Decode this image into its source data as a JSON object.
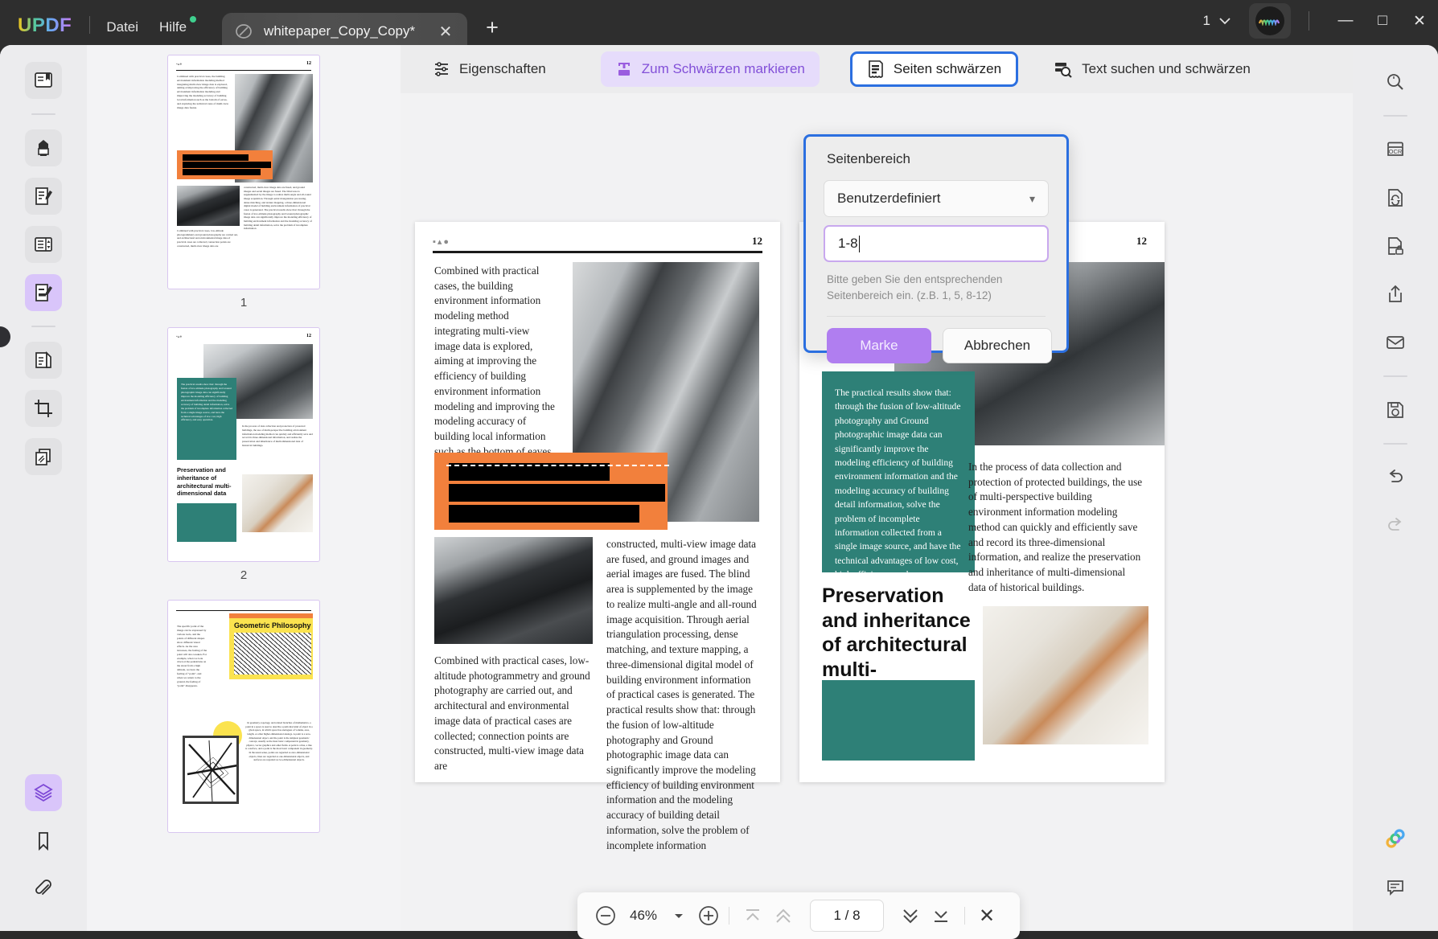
{
  "titlebar": {
    "logo": "UPDF",
    "menus": [
      "Datei",
      "Hilfe"
    ],
    "tab": {
      "title": "whitepaper_Copy_Copy*",
      "close": "✕",
      "add": "+",
      "icon": "document-slash-icon"
    },
    "window_count": "1",
    "chevron": "⌄",
    "minimize": "—",
    "maximize": "□",
    "close": "✕"
  },
  "left_rail": {
    "items": [
      {
        "name": "reader-mode",
        "icon": "book-bookmark-icon",
        "state": "idle"
      },
      {
        "name": "highlight-tool",
        "icon": "marker-pen-icon",
        "state": "idle"
      },
      {
        "name": "annotate-tool",
        "icon": "document-pen-icon",
        "state": "idle"
      },
      {
        "name": "organize-pages",
        "icon": "page-list-icon",
        "state": "idle"
      },
      {
        "name": "redact-tool",
        "icon": "document-edit-icon",
        "state": "active"
      },
      {
        "name": "page-tool",
        "icon": "document-copy-icon",
        "state": "idle"
      },
      {
        "name": "crop-tool",
        "icon": "crop-icon",
        "state": "idle"
      },
      {
        "name": "stamp-tool",
        "icon": "layers-stack-icon",
        "state": "idle"
      }
    ],
    "bottom": [
      {
        "name": "thumbnails-panel",
        "icon": "layers-icon",
        "state": "active"
      },
      {
        "name": "bookmarks-panel",
        "icon": "bookmark-icon",
        "state": "idle"
      },
      {
        "name": "attachments-panel",
        "icon": "paperclip-icon",
        "state": "idle"
      }
    ]
  },
  "right_rail": {
    "items": [
      {
        "name": "search",
        "icon": "magnifier-icon"
      },
      {
        "name": "ocr",
        "icon": "ocr-icon"
      },
      {
        "name": "convert",
        "icon": "document-refresh-icon"
      },
      {
        "name": "protect",
        "icon": "document-lock-icon"
      },
      {
        "name": "share",
        "icon": "share-upload-icon"
      },
      {
        "name": "email",
        "icon": "envelope-icon"
      },
      {
        "name": "save",
        "icon": "floppy-disk-icon"
      },
      {
        "name": "undo",
        "icon": "undo-arrow-icon"
      },
      {
        "name": "redo",
        "icon": "redo-arrow-icon"
      }
    ],
    "bottom": [
      {
        "name": "ai-assistant",
        "icon": "ai-flower-icon"
      },
      {
        "name": "comments",
        "icon": "comment-bubble-icon"
      }
    ]
  },
  "toolbar": {
    "properties_label": "Eigenschaften",
    "properties_icon": "sliders-icon",
    "mark_label": "Zum Schwärzen markieren",
    "mark_icon": "redact-text-icon",
    "pages_label": "Seiten schwärzen",
    "pages_icon": "redact-page-icon",
    "search_label": "Text suchen und schwärzen",
    "search_icon": "search-redact-icon"
  },
  "dialog": {
    "title": "Seitenbereich",
    "select_value": "Benutzerdefiniert",
    "select_caret": "▾",
    "input_value": "1-8",
    "input_placeholder": "1-8",
    "hint": "Bitte geben Sie den entsprechenden Seitenbereich ein. (z.B. 1, 5, 8-12)",
    "primary_button": "Marke",
    "secondary_button": "Abbrechen"
  },
  "thumbnails": [
    {
      "label": "1"
    },
    {
      "label": "2"
    },
    {
      "label": ""
    }
  ],
  "bottombar": {
    "zoom_out": "−",
    "zoom_value": "46%",
    "zoom_caret": "▾",
    "zoom_in": "+",
    "first_page": "first-page-icon",
    "prev_page": "prev-page-icon",
    "page_indicator": "1 / 8",
    "next_page": "next-page-icon",
    "last_page": "last-page-icon",
    "close": "✕"
  },
  "document": {
    "page_number": "12",
    "left_page": {
      "col1": "Combined with practical cases, the building environment information modeling method integrating multi-view image data is explored, aiming at improving the efficiency of building environment information modeling and improving the modeling accuracy of building local information such as the bottom of eaves, and exploring the technical route of multi-view image data fusion.",
      "col_left_bottom": "Combined with practical cases, low-altitude photogrammetry and ground photography are carried out, and architectural and environmental image data of practical cases are collected; connection points are constructed, multi-view image data are",
      "col_right": "constructed, multi-view image data are fused, and ground images and aerial images are fused. The blind area is supplemented by the image to realize multi-angle and all-round image acquisition. Through aerial triangulation processing, dense matching, and texture mapping, a three-dimensional digital model of building environment information of practical cases is generated. The practical results show that: through the fusion of low-altitude photography and Ground photographic image data can significantly improve the modeling efficiency of building environment information and the modeling accuracy of building detail information, solve the problem of incomplete information"
    },
    "right_page": {
      "teal_block": "The practical results show that: through the fusion of low-altitude photography and Ground photographic image data can significantly improve the modeling efficiency of building environment information and the modeling accuracy of building detail information, solve the problem of incomplete information collected from a single image source, and have the technical advantages of low cost, high efficiency, and easy operation.",
      "body": "In the process of data collection and protection of protected buildings, the use of multi-perspective building environment information modeling method can quickly and efficiently save and record its three-dimensional information, and realize the preservation and inheritance of multi-dimensional data of historical buildings.",
      "heading": "Preservation and inheritance of architectural multi-dimensional data"
    },
    "thumb3": {
      "title": "Geometric Philosophy",
      "left_text": "The specific point of the image can be expressed by various tools, and the points of different shapes show different visual effects. As the area increases, the feeling of the point will also weaken. For example, when we look down at the pedestrians on the street from a high altitude, we have the feeling of \"point\", and when we return to the ground, the feeling of \"point\" disappears.",
      "right_text": "In geometry, topology, and related branches of mathematics, a point in a space is used to describe a particular kind of object in a given space, in which space has analogues of volume, area, length, or other higher-dimensional analogs. A point is a zero-dimensional object, and the point is the simplest geometric concept, usually as the most basic component in geometry, physics, vector graphics and other fields. A point is a line, a line is a surface, and a point is the most basic component in geometry. In the usual sense, points are regarded as zero-dimensional objects, lines are regarded as one-dimensional objects, and surfaces are regarded as two-dimensional objects."
    }
  },
  "colors": {
    "accent_purple": "#b07ef0",
    "focus_blue": "#2b6fe0",
    "teal": "#2e8077",
    "orange": "#f2803c",
    "redact_black": "#000000"
  }
}
